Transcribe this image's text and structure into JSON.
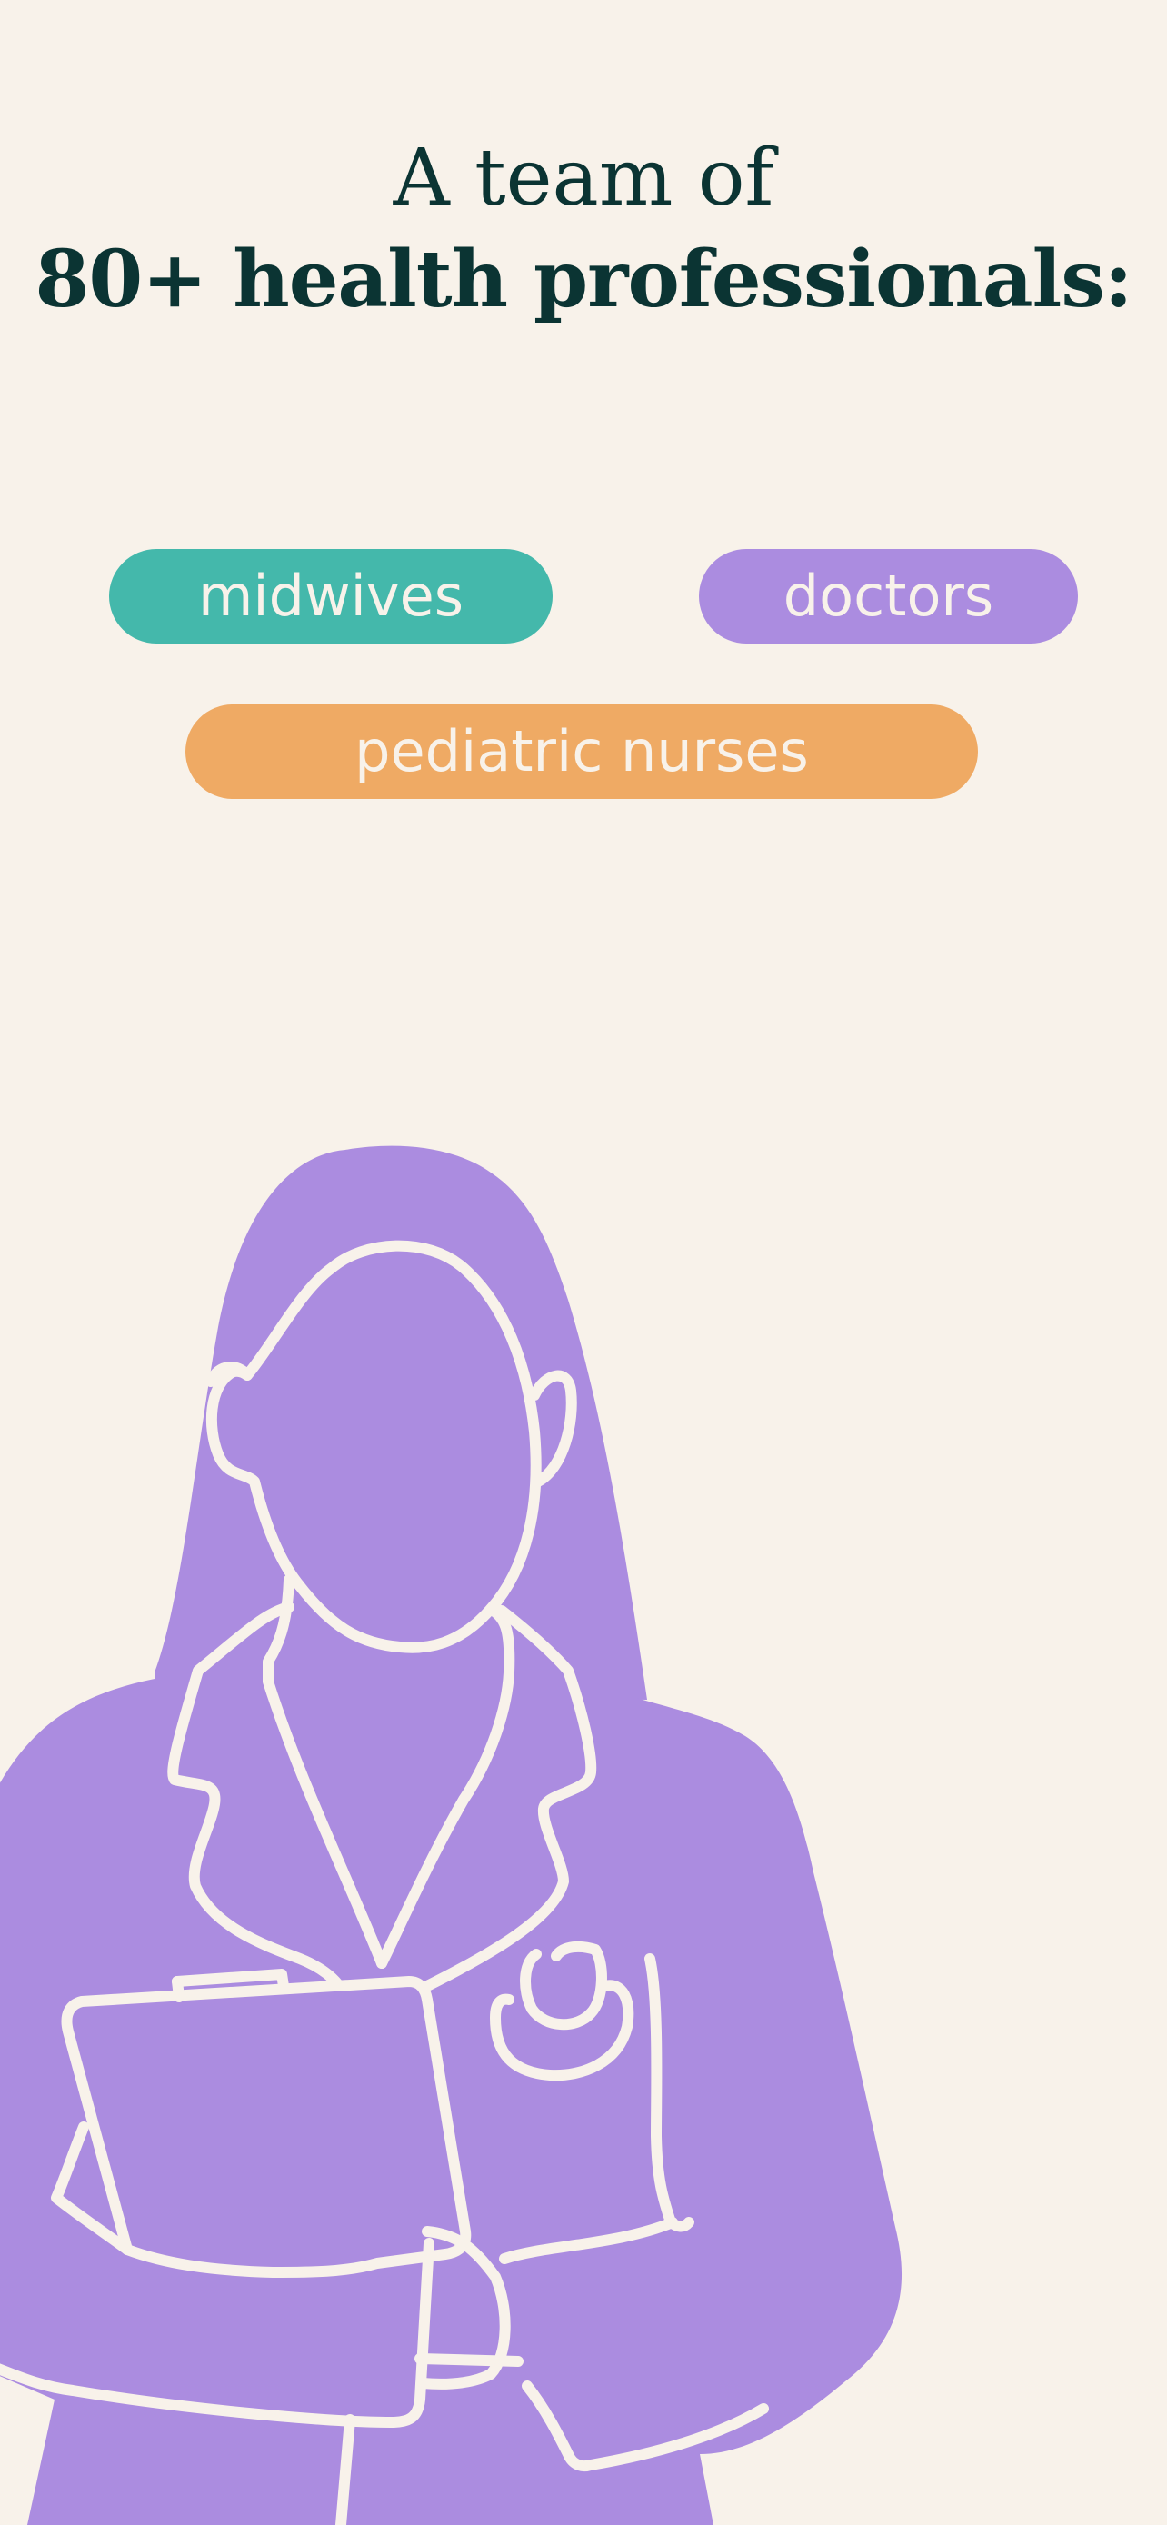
{
  "headline": {
    "line1": "A team of",
    "line2": "80+ health professionals:"
  },
  "tags": [
    {
      "label": "midwives",
      "color": "#44b8ab"
    },
    {
      "label": "doctors",
      "color": "#ab8ce0"
    },
    {
      "label": "pediatric nurses",
      "color": "#efaa64"
    }
  ],
  "colors": {
    "background": "#f8f2ea",
    "headline": "#0b3433",
    "illustration_fill": "#ab8ce0",
    "illustration_stroke": "#f8f2ea"
  },
  "illustration": {
    "icon": "doctor-with-clipboard-and-stethoscope-illustration"
  }
}
